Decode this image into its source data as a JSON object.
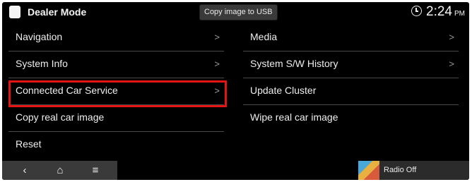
{
  "status_bar": {
    "title": "Dealer Mode",
    "tooltip": "Copy image to USB",
    "time": "2:24",
    "ampm": "PM"
  },
  "menu": {
    "left": [
      {
        "label": "Navigation",
        "chevron": ">"
      },
      {
        "label": "System Info",
        "chevron": ">"
      },
      {
        "label": "Connected Car Service",
        "chevron": ">",
        "highlighted": true
      },
      {
        "label": "Copy real car image"
      },
      {
        "label": "Reset"
      }
    ],
    "right": [
      {
        "label": "Media",
        "chevron": ">"
      },
      {
        "label": "System S/W History",
        "chevron": ">"
      },
      {
        "label": "Update Cluster"
      },
      {
        "label": "Wipe real car image"
      }
    ]
  },
  "nav_bar": {
    "back_glyph": "‹",
    "home_glyph": "⌂",
    "menu_glyph": "≡"
  },
  "media_widget": {
    "label": "Radio Off"
  },
  "colors": {
    "background": "#000000",
    "highlight_border": "#e51414",
    "divider": "#4a4a4a",
    "nav_bar": "#3a3a3a"
  }
}
